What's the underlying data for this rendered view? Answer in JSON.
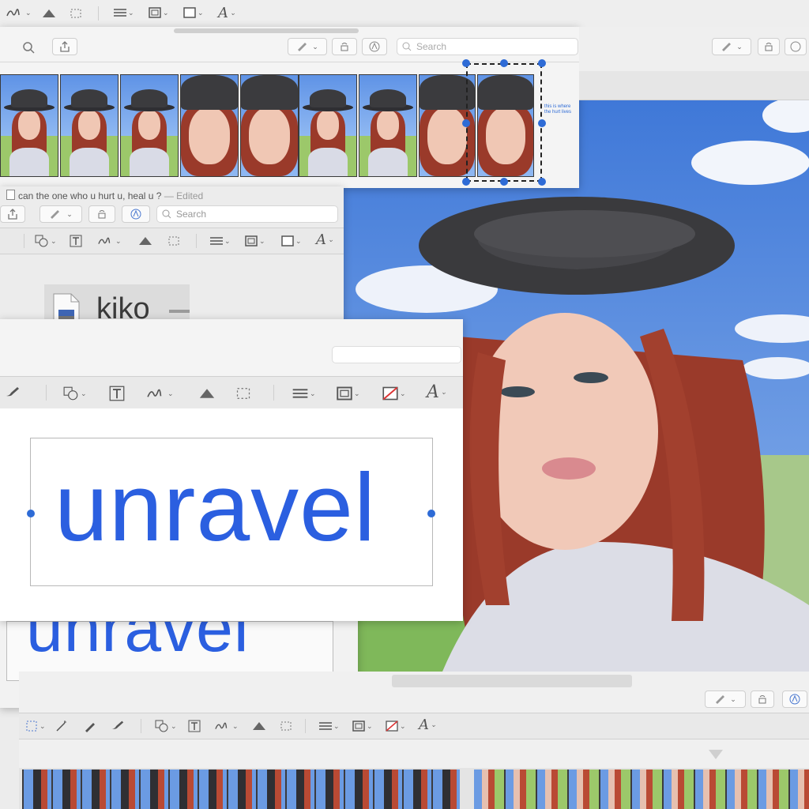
{
  "top_window": {
    "search_placeholder": "Search",
    "tiny_note": "this is where the hurt lives"
  },
  "middle_window": {
    "title": "can the one who u hurt u, heal u ?",
    "edited_suffix": "— Edited",
    "search_placeholder": "Search",
    "file_label": "kiko"
  },
  "text_window": {
    "main_word": "unravel",
    "shadow_word": "unravel"
  },
  "colors": {
    "accent_blue": "#2e6bd6",
    "text_blue": "#2b5fe0",
    "sky": "#4f86df",
    "hair": "#9a3a2a"
  },
  "icons": [
    "pen-icon",
    "shapes-icon",
    "text-box-icon",
    "signature-icon",
    "adjust-color-icon",
    "crop-icon",
    "lines-icon",
    "border-icon",
    "fill-icon",
    "font-icon",
    "share-icon",
    "rotate-icon",
    "markup-icon",
    "zoom-icon",
    "search-icon"
  ]
}
